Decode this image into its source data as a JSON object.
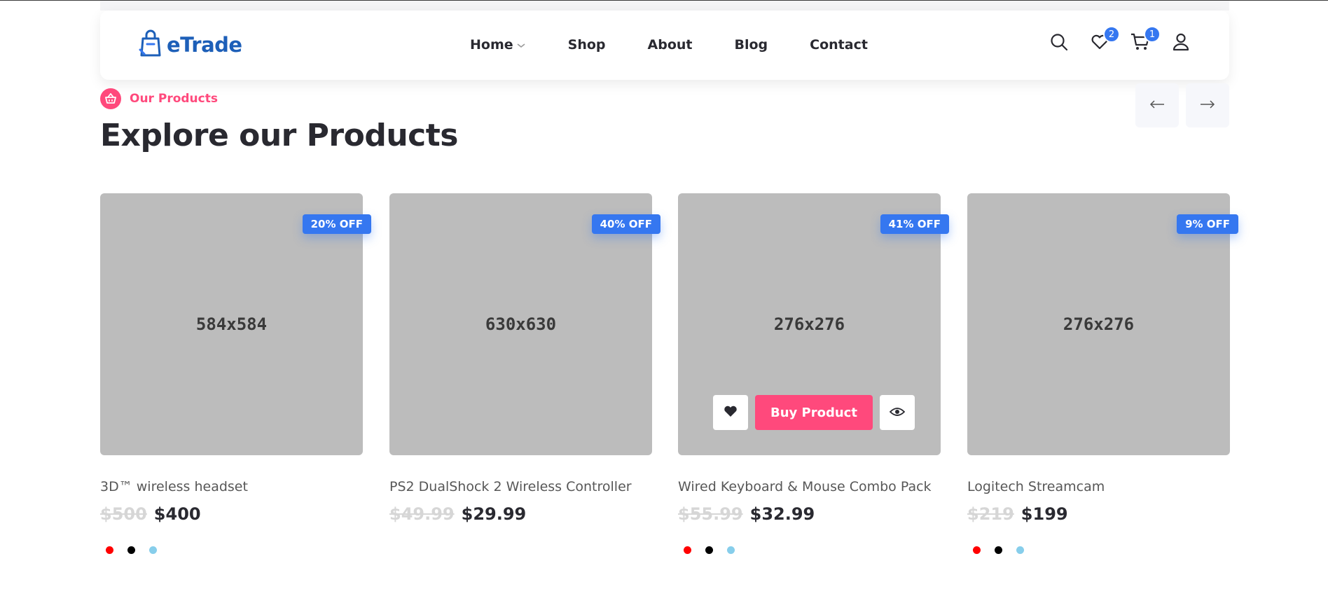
{
  "header": {
    "logo_text": "eTrade",
    "nav": [
      {
        "label": "Home",
        "has_dropdown": true
      },
      {
        "label": "Shop"
      },
      {
        "label": "About"
      },
      {
        "label": "Blog"
      },
      {
        "label": "Contact"
      }
    ],
    "icons": {
      "search": "search-icon",
      "wishlist": "heart-icon",
      "cart": "cart-icon",
      "user": "user-icon"
    },
    "wishlist_count": "2",
    "cart_count": "1"
  },
  "section": {
    "tag": "Our Products",
    "title": "Explore our Products"
  },
  "colors": {
    "accent": "#3577f0",
    "pink": "#ff497c",
    "placeholder": "#bcbcbc"
  },
  "products": [
    {
      "image_label": "584x584",
      "discount": "20% OFF",
      "title": "3D™ wireless headset",
      "old_price": "$500",
      "price": "$400",
      "swatches": [
        "#ff0000",
        "#000000",
        "#87ceeb"
      ]
    },
    {
      "image_label": "630x630",
      "discount": "40% OFF",
      "title": "PS2 DualShock 2 Wireless Controller",
      "old_price": "$49.99",
      "price": "$29.99",
      "swatches": []
    },
    {
      "image_label": "276x276",
      "discount": "41% OFF",
      "title": "Wired Keyboard & Mouse Combo Pack",
      "old_price": "$55.99",
      "price": "$32.99",
      "swatches": [
        "#ff0000",
        "#000000",
        "#87ceeb"
      ],
      "buy_label": "Buy Product"
    },
    {
      "image_label": "276x276",
      "discount": "9% OFF",
      "title": "Logitech Streamcam",
      "old_price": "$219",
      "price": "$199",
      "swatches": [
        "#ff0000",
        "#000000",
        "#87ceeb"
      ]
    }
  ]
}
